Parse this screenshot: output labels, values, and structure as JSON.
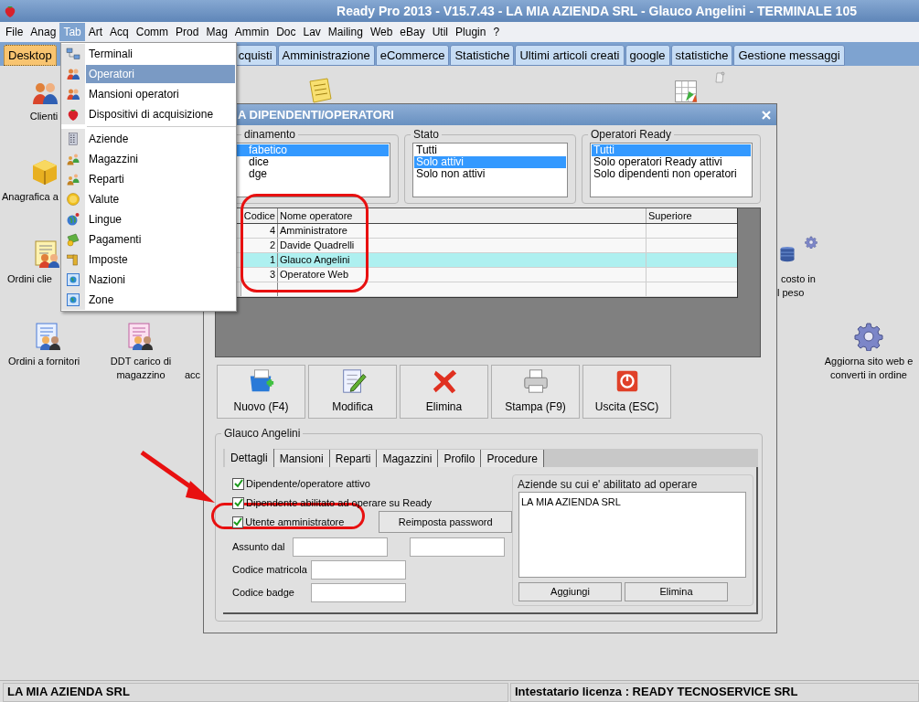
{
  "window": {
    "title": "Ready Pro 2013 - V15.7.43 - LA MIA AZIENDA SRL - Glauco Angelini - TERMINALE 105"
  },
  "menu_bar": [
    {
      "label": "File",
      "selected": false
    },
    {
      "label": "Anag",
      "selected": false
    },
    {
      "label": "Tab",
      "selected": true
    },
    {
      "label": "Art",
      "selected": false
    },
    {
      "label": "Acq",
      "selected": false
    },
    {
      "label": "Comm",
      "selected": false
    },
    {
      "label": "Prod",
      "selected": false
    },
    {
      "label": "Mag",
      "selected": false
    },
    {
      "label": "Ammin",
      "selected": false
    },
    {
      "label": "Doc",
      "selected": false
    },
    {
      "label": "Lav",
      "selected": false
    },
    {
      "label": "Mailing",
      "selected": false
    },
    {
      "label": "Web",
      "selected": false
    },
    {
      "label": "eBay",
      "selected": false
    },
    {
      "label": "Util",
      "selected": false
    },
    {
      "label": "Plugin",
      "selected": false
    },
    {
      "label": "?",
      "selected": false
    }
  ],
  "open_menu": {
    "groups": [
      [
        {
          "label": "Terminali",
          "kind": "network",
          "selected": false
        },
        {
          "label": "Operatori",
          "kind": "people",
          "selected": true
        },
        {
          "label": "Mansioni operatori",
          "kind": "people",
          "selected": false
        },
        {
          "label": "Dispositivi di acquisizione",
          "kind": "strawberry",
          "selected": false
        }
      ],
      [
        {
          "label": "Aziende",
          "kind": "building",
          "selected": false
        },
        {
          "label": "Magazzini",
          "kind": "group",
          "selected": false
        },
        {
          "label": "Reparti",
          "kind": "group",
          "selected": false
        },
        {
          "label": "Valute",
          "kind": "coin",
          "selected": false
        },
        {
          "label": "Lingue",
          "kind": "globe",
          "selected": false
        },
        {
          "label": "Pagamenti",
          "kind": "money",
          "selected": false
        },
        {
          "label": "Imposte",
          "kind": "tap",
          "selected": false
        },
        {
          "label": "Nazioni",
          "kind": "map",
          "selected": false
        },
        {
          "label": "Zone",
          "kind": "map",
          "selected": false
        }
      ]
    ]
  },
  "tabs": [
    {
      "label": "Desktop",
      "selected": true
    },
    {
      "label": "cquisti",
      "selected": false
    },
    {
      "label": "Amministrazione",
      "selected": false
    },
    {
      "label": "eCommerce",
      "selected": false
    },
    {
      "label": "Statistiche",
      "selected": false
    },
    {
      "label": "Ultimi articoli creati",
      "selected": false
    },
    {
      "label": "google",
      "selected": false
    },
    {
      "label": "statistiche",
      "selected": false
    },
    {
      "label": "Gestione messaggi",
      "selected": false
    }
  ],
  "desktop_icons": [
    {
      "label": "Clienti",
      "kind": "people"
    },
    {
      "label": "Anagrafica a",
      "kind": "box"
    },
    {
      "label": "Ordini clie",
      "kind": "order"
    },
    {
      "label": "Ordini a fornitori",
      "kind": "supplier"
    },
    {
      "label": "DDT carico di magazzino",
      "kind": "delivery"
    },
    {
      "label": "acc"
    },
    {
      "kind": "note"
    },
    {
      "kind": "grid"
    },
    {
      "kind": "scroll"
    },
    {
      "label": "costo in",
      "kind": "database"
    },
    {
      "label": "l peso"
    },
    {
      "kind": "small-gear"
    },
    {
      "label": "Aggiorna sito web e converti in ordine",
      "kind": "gear"
    }
  ],
  "dialog": {
    "title": "A DIPENDENTI/OPERATORI",
    "filters": [
      {
        "title": "dinamento",
        "options": [
          {
            "label": "fabetico",
            "selected": true
          },
          {
            "label": "dice",
            "selected": false
          },
          {
            "label": "dge",
            "selected": false
          }
        ]
      },
      {
        "title": "Stato",
        "options": [
          {
            "label": "Tutti",
            "selected": false
          },
          {
            "label": "Solo attivi",
            "selected": true
          },
          {
            "label": "Solo non attivi",
            "selected": false
          }
        ]
      },
      {
        "title": "Operatori Ready",
        "options": [
          {
            "label": "Tutti",
            "selected": true
          },
          {
            "label": "Solo operatori Ready attivi",
            "selected": false
          },
          {
            "label": "Solo dipendenti non operatori",
            "selected": false
          }
        ]
      }
    ],
    "table": {
      "columns": [
        "Codice",
        "Nome operatore",
        "Superiore"
      ],
      "rows": [
        {
          "code": "4",
          "name": "Amministratore",
          "selected": false
        },
        {
          "code": "2",
          "name": "Davide Quadrelli",
          "selected": false
        },
        {
          "code": "1",
          "name": "Glauco Angelini",
          "selected": true
        },
        {
          "code": "3",
          "name": "Operatore Web",
          "selected": false
        }
      ]
    },
    "toolbar": [
      {
        "label": "Nuovo (F4)",
        "kind": "new"
      },
      {
        "label": "Modifica",
        "kind": "edit"
      },
      {
        "label": "Elimina",
        "kind": "delete"
      },
      {
        "label": "Stampa (F9)",
        "kind": "print"
      },
      {
        "label": "Uscita (ESC)",
        "kind": "exit"
      }
    ],
    "detail": {
      "title": "Glauco Angelini",
      "tabs": [
        {
          "label": "Dettagli",
          "selected": true
        },
        {
          "label": "Mansioni",
          "selected": false
        },
        {
          "label": "Reparti",
          "selected": false
        },
        {
          "label": "Magazzini",
          "selected": false
        },
        {
          "label": "Profilo",
          "selected": false
        },
        {
          "label": "Procedure",
          "selected": false
        }
      ],
      "checkboxes": [
        {
          "label": "Dipendente/operatore attivo",
          "checked": true
        },
        {
          "label": "Dipendente abilitato ad operare su Ready",
          "checked": true
        },
        {
          "label": "Utente amministratore",
          "checked": true
        }
      ],
      "reset_button": "Reimposta password",
      "fields": [
        {
          "label": "Assunto dal"
        },
        {
          "label": "Codice matricola"
        },
        {
          "label": "Codice badge"
        }
      ],
      "companies": {
        "title": "Aziende su cui e' abilitato ad operare",
        "items": [
          "LA MIA AZIENDA SRL"
        ],
        "buttons": [
          "Aggiungi",
          "Elimina"
        ]
      }
    }
  },
  "status_bar": {
    "company": "LA MIA AZIENDA SRL",
    "license": "Intestatario licenza : READY TECNOSERVICE SRL"
  }
}
